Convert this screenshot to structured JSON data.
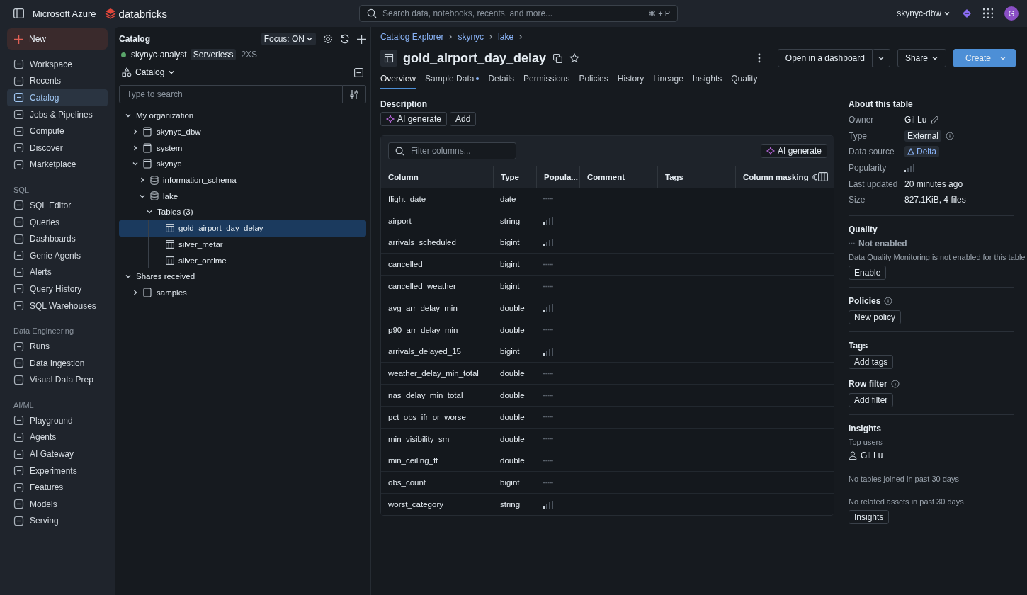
{
  "topbar": {
    "brand": "Microsoft Azure",
    "logo_text": "databricks",
    "search": {
      "placeholder": "Search data, notebooks, recents, and more...",
      "shortcut": "⌘ + P"
    },
    "workspace": "skynyc-dbw",
    "avatar": "G"
  },
  "sidebar": {
    "new_button": "New",
    "sections": [
      {
        "items": [
          {
            "label": "Workspace",
            "selected": false
          },
          {
            "label": "Recents",
            "selected": false
          },
          {
            "label": "Catalog",
            "selected": true
          },
          {
            "label": "Jobs & Pipelines",
            "selected": false
          },
          {
            "label": "Compute",
            "selected": false
          },
          {
            "label": "Discover",
            "selected": false
          },
          {
            "label": "Marketplace",
            "selected": false
          }
        ]
      },
      {
        "heading": "SQL",
        "items": [
          {
            "label": "SQL Editor",
            "selected": false
          },
          {
            "label": "Queries",
            "selected": false
          },
          {
            "label": "Dashboards",
            "selected": false
          },
          {
            "label": "Genie Agents",
            "selected": false
          },
          {
            "label": "Alerts",
            "selected": false
          },
          {
            "label": "Query History",
            "selected": false
          },
          {
            "label": "SQL Warehouses",
            "selected": false
          }
        ]
      },
      {
        "heading": "Data Engineering",
        "items": [
          {
            "label": "Runs",
            "selected": false
          },
          {
            "label": "Data Ingestion",
            "selected": false
          },
          {
            "label": "Visual Data Prep",
            "selected": false
          }
        ]
      },
      {
        "heading": "AI/ML",
        "items": [
          {
            "label": "Playground",
            "selected": false
          },
          {
            "label": "Agents",
            "selected": false
          },
          {
            "label": "AI Gateway",
            "selected": false
          },
          {
            "label": "Experiments",
            "selected": false
          },
          {
            "label": "Features",
            "selected": false
          },
          {
            "label": "Models",
            "selected": false
          },
          {
            "label": "Serving",
            "selected": false
          }
        ]
      }
    ]
  },
  "catalog_panel": {
    "title": "Catalog",
    "focus": "Focus: ON",
    "compute": {
      "name": "skynyc-analyst",
      "type": "Serverless",
      "size": "2XS"
    },
    "selector": "Catalog",
    "search": {
      "placeholder": "Type to search"
    },
    "tree": [
      {
        "label": "My organization",
        "expanded": true,
        "selected": false,
        "children": [
          {
            "label": "skynyc_dbw",
            "kind": "catalog",
            "expanded": false,
            "selected": false
          },
          {
            "label": "system",
            "kind": "catalog",
            "expanded": false,
            "selected": false
          },
          {
            "label": "skynyc",
            "kind": "catalog",
            "expanded": true,
            "selected": false,
            "children": [
              {
                "label": "information_schema",
                "kind": "schema",
                "expanded": false,
                "selected": false
              },
              {
                "label": "lake",
                "kind": "schema",
                "expanded": true,
                "selected": false,
                "children": [
                  {
                    "label": "Tables (3)",
                    "expanded": true,
                    "selected": false,
                    "children": [
                      {
                        "label": "gold_airport_day_delay",
                        "kind": "table",
                        "selected": true
                      },
                      {
                        "label": "silver_metar",
                        "kind": "table",
                        "selected": false
                      },
                      {
                        "label": "silver_ontime",
                        "kind": "table",
                        "selected": false
                      }
                    ]
                  }
                ]
              }
            ]
          }
        ]
      },
      {
        "label": "Shares received",
        "expanded": true,
        "selected": false,
        "children": [
          {
            "label": "samples",
            "kind": "catalog",
            "expanded": false,
            "selected": false
          }
        ]
      }
    ]
  },
  "main": {
    "breadcrumbs": [
      "Catalog Explorer",
      "skynyc",
      "lake"
    ],
    "title": "gold_airport_day_delay",
    "actions": {
      "open": "Open in a dashboard",
      "share": "Share",
      "create": "Create"
    },
    "tabs": [
      {
        "label": "Overview",
        "selected": true,
        "dot": false
      },
      {
        "label": "Sample Data",
        "selected": false,
        "dot": true
      },
      {
        "label": "Details",
        "selected": false,
        "dot": false
      },
      {
        "label": "Permissions",
        "selected": false,
        "dot": false
      },
      {
        "label": "Policies",
        "selected": false,
        "dot": false
      },
      {
        "label": "History",
        "selected": false,
        "dot": false
      },
      {
        "label": "Lineage",
        "selected": false,
        "dot": false
      },
      {
        "label": "Insights",
        "selected": false,
        "dot": false
      },
      {
        "label": "Quality",
        "selected": false,
        "dot": false
      }
    ],
    "description": {
      "label": "Description",
      "ai_button": "AI generate",
      "add_button": "Add"
    },
    "columns_table": {
      "filter_placeholder": "Filter columns...",
      "ai_button": "AI generate",
      "columns": [
        "Column",
        "Type",
        "Popula...",
        "Comment",
        "Tags",
        "Column masking"
      ],
      "rows": [
        {
          "name": "flight_date",
          "type": "date",
          "popular": false
        },
        {
          "name": "airport",
          "type": "string",
          "popular": true
        },
        {
          "name": "arrivals_scheduled",
          "type": "bigint",
          "popular": true
        },
        {
          "name": "cancelled",
          "type": "bigint",
          "popular": false
        },
        {
          "name": "cancelled_weather",
          "type": "bigint",
          "popular": false
        },
        {
          "name": "avg_arr_delay_min",
          "type": "double",
          "popular": true
        },
        {
          "name": "p90_arr_delay_min",
          "type": "double",
          "popular": false
        },
        {
          "name": "arrivals_delayed_15",
          "type": "bigint",
          "popular": true
        },
        {
          "name": "weather_delay_min_total",
          "type": "double",
          "popular": false
        },
        {
          "name": "nas_delay_min_total",
          "type": "double",
          "popular": false
        },
        {
          "name": "pct_obs_ifr_or_worse",
          "type": "double",
          "popular": false
        },
        {
          "name": "min_visibility_sm",
          "type": "double",
          "popular": false
        },
        {
          "name": "min_ceiling_ft",
          "type": "double",
          "popular": false
        },
        {
          "name": "obs_count",
          "type": "bigint",
          "popular": false
        },
        {
          "name": "worst_category",
          "type": "string",
          "popular": true
        }
      ]
    }
  },
  "about": {
    "title": "About this table",
    "properties": [
      {
        "label": "Owner",
        "kind": "editable",
        "value": "Gil Lu"
      },
      {
        "label": "Type",
        "kind": "badge",
        "value": "External",
        "info": true
      },
      {
        "label": "Data source",
        "kind": "link",
        "value": "Delta"
      },
      {
        "label": "Popularity",
        "kind": "popularity",
        "popular": true
      },
      {
        "label": "Last updated",
        "kind": "text",
        "value": "20 minutes ago"
      },
      {
        "label": "Size",
        "kind": "text",
        "value": "827.1KiB, 4 files"
      }
    ],
    "groups": [
      {
        "sections": [
          {
            "title": "Quality",
            "info": false,
            "status": "Not enabled",
            "note": "Data Quality Monitoring is not enabled for this table",
            "button": "Enable"
          }
        ]
      },
      {
        "sections": [
          {
            "title": "Policies",
            "info": true,
            "button": "New policy"
          }
        ]
      },
      {
        "sections": [
          {
            "title": "Tags",
            "info": false,
            "button": "Add tags"
          },
          {
            "title": "Row filter",
            "info": true,
            "button": "Add filter"
          }
        ]
      },
      {
        "sections": [
          {
            "title": "Insights",
            "info": false,
            "subtitle": "Top users",
            "user": "Gil Lu",
            "notes": [
              "No tables joined in past 30 days",
              "No related assets in past 30 days"
            ],
            "button": "Insights"
          }
        ]
      }
    ]
  }
}
